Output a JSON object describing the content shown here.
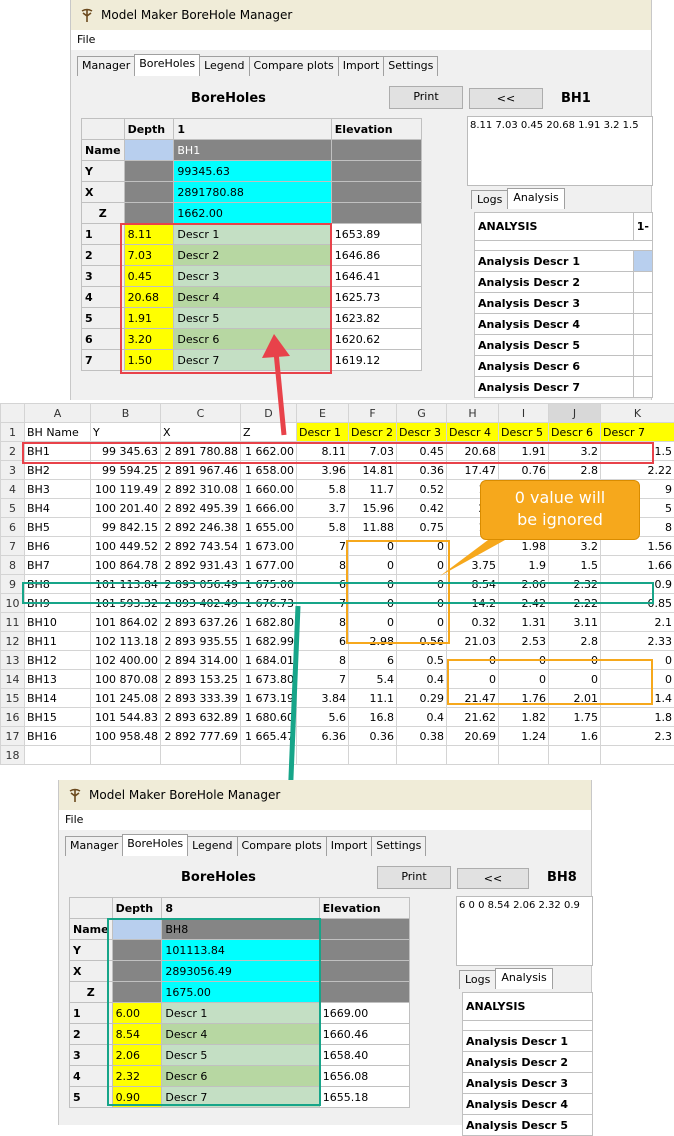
{
  "app": {
    "title": "Model Maker BoreHole Manager",
    "menu_file": "File"
  },
  "tabs": [
    "Manager",
    "BoreHoles",
    "Legend",
    "Compare plots",
    "Import",
    "Settings"
  ],
  "top": {
    "section_label": "BoreHoles",
    "print_label": "Print",
    "prev_label": "<<",
    "bh_label": "BH1",
    "memo": "8.11 7.03 0.45 20.68 1.91 3.2 1.5",
    "subtabs": [
      "Logs",
      "Analysis"
    ],
    "grid_headers": {
      "depth": "Depth",
      "col1": "1",
      "elev": "Elevation"
    },
    "info_rows": [
      {
        "label": "Name",
        "value": "BH1"
      },
      {
        "label": "Y",
        "value": "99345.63"
      },
      {
        "label": "X",
        "value": "2891780.88"
      },
      {
        "label": "Z",
        "value": "1662.00"
      }
    ],
    "rows": [
      {
        "n": "1",
        "depth": "8.11",
        "descr": "Descr 1",
        "elev": "1653.89"
      },
      {
        "n": "2",
        "depth": "7.03",
        "descr": "Descr 2",
        "elev": "1646.86"
      },
      {
        "n": "3",
        "depth": "0.45",
        "descr": "Descr 3",
        "elev": "1646.41"
      },
      {
        "n": "4",
        "depth": "20.68",
        "descr": "Descr 4",
        "elev": "1625.73"
      },
      {
        "n": "5",
        "depth": "1.91",
        "descr": "Descr 5",
        "elev": "1623.82"
      },
      {
        "n": "6",
        "depth": "3.20",
        "descr": "Descr 6",
        "elev": "1620.62"
      },
      {
        "n": "7",
        "depth": "1.50",
        "descr": "Descr 7",
        "elev": "1619.12"
      }
    ],
    "analysis_header": "ANALYSIS",
    "analysis_col": "1-",
    "analysis_rows": [
      "Analysis Descr 1",
      "Analysis Descr 2",
      "Analysis Descr 3",
      "Analysis Descr 4",
      "Analysis Descr 5",
      "Analysis Descr 6",
      "Analysis Descr 7"
    ]
  },
  "sheet": {
    "columns": [
      "A",
      "B",
      "C",
      "D",
      "E",
      "F",
      "G",
      "H",
      "I",
      "J",
      "K"
    ],
    "header": [
      "BH Name",
      "Y",
      "X",
      "Z",
      "Descr 1",
      "Descr 2",
      "Descr 3",
      "Descr 4",
      "Descr 5",
      "Descr 6",
      "Descr 7"
    ],
    "rows": [
      [
        "BH1",
        "99 345.63",
        "2 891 780.88",
        "1 662.00",
        "8.11",
        "7.03",
        "0.45",
        "20.68",
        "1.91",
        "3.2",
        "1.5"
      ],
      [
        "BH2",
        "99 594.25",
        "2 891 967.46",
        "1 658.00",
        "3.96",
        "14.81",
        "0.36",
        "17.47",
        "0.76",
        "2.8",
        "2.22"
      ],
      [
        "BH3",
        "100 119.49",
        "2 892 310.08",
        "1 660.00",
        "5.8",
        "11.7",
        "0.52",
        "19.",
        "",
        "",
        "9"
      ],
      [
        "BH4",
        "100 201.40",
        "2 892 495.39",
        "1 666.00",
        "3.7",
        "15.96",
        "0.42",
        "21.",
        "",
        "",
        "5"
      ],
      [
        "BH5",
        "99 842.15",
        "2 892 246.38",
        "1 655.00",
        "5.8",
        "11.88",
        "0.75",
        "19.",
        "",
        "",
        "8"
      ],
      [
        "BH6",
        "100 449.52",
        "2 892 743.54",
        "1 673.00",
        "7",
        "0",
        "0",
        "",
        "1.98",
        "3.2",
        "1.56"
      ],
      [
        "BH7",
        "100 864.78",
        "2 892 931.43",
        "1 677.00",
        "8",
        "0",
        "0",
        "3.75",
        "1.9",
        "1.5",
        "1.66"
      ],
      [
        "BH8",
        "101 113.84",
        "2 893 056.49",
        "1 675.00",
        "6",
        "0",
        "0",
        "8.54",
        "2.06",
        "2.32",
        "0.9"
      ],
      [
        "BH9",
        "101 593.32",
        "2 893 402.49",
        "1 676.73",
        "7",
        "0",
        "0",
        "14.2",
        "2.42",
        "2.22",
        "0.85"
      ],
      [
        "BH10",
        "101 864.02",
        "2 893 637.26",
        "1 682.80",
        "8",
        "0",
        "0",
        "0.32",
        "1.31",
        "3.11",
        "2.1"
      ],
      [
        "BH11",
        "102 113.18",
        "2 893 935.55",
        "1 682.99",
        "6",
        "2.98",
        "0.56",
        "21.03",
        "2.53",
        "2.8",
        "2.33"
      ],
      [
        "BH12",
        "102 400.00",
        "2 894 314.00",
        "1 684.01",
        "8",
        "6",
        "0.5",
        "0",
        "0",
        "0",
        "0"
      ],
      [
        "BH13",
        "100 870.08",
        "2 893 153.25",
        "1 673.80",
        "7",
        "5.4",
        "0.4",
        "0",
        "0",
        "0",
        "0"
      ],
      [
        "BH14",
        "101 245.08",
        "2 893 333.39",
        "1 673.19",
        "3.84",
        "11.1",
        "0.29",
        "21.47",
        "1.76",
        "2.01",
        "1.4"
      ],
      [
        "BH15",
        "101 544.83",
        "2 893 632.89",
        "1 680.60",
        "5.6",
        "16.8",
        "0.4",
        "21.62",
        "1.82",
        "1.75",
        "1.8"
      ],
      [
        "BH16",
        "100 958.48",
        "2 892 777.69",
        "1 665.47",
        "6.36",
        "0.36",
        "0.38",
        "20.69",
        "1.24",
        "1.6",
        "2.3"
      ]
    ],
    "row_numbers": [
      "1",
      "2",
      "3",
      "4",
      "5",
      "6",
      "7",
      "8",
      "9",
      "10",
      "11",
      "12",
      "13",
      "14",
      "15",
      "16",
      "17",
      "18"
    ]
  },
  "callout": {
    "line1": "0  value  will",
    "line2": "be ignored"
  },
  "bottom": {
    "section_label": "BoreHoles",
    "print_label": "Print",
    "prev_label": "<<",
    "bh_label": "BH8",
    "memo": "6 0 0 8.54 2.06 2.32 0.9",
    "subtabs": [
      "Logs",
      "Analysis"
    ],
    "grid_headers": {
      "depth": "Depth",
      "col1": "8",
      "elev": "Elevation"
    },
    "info_rows": [
      {
        "label": "Name",
        "value": "BH8"
      },
      {
        "label": "Y",
        "value": "101113.84"
      },
      {
        "label": "X",
        "value": "2893056.49"
      },
      {
        "label": "Z",
        "value": "1675.00"
      }
    ],
    "rows": [
      {
        "n": "1",
        "depth": "6.00",
        "descr": "Descr 1",
        "elev": "1669.00"
      },
      {
        "n": "2",
        "depth": "8.54",
        "descr": "Descr 4",
        "elev": "1660.46"
      },
      {
        "n": "3",
        "depth": "2.06",
        "descr": "Descr 5",
        "elev": "1658.40"
      },
      {
        "n": "4",
        "depth": "2.32",
        "descr": "Descr 6",
        "elev": "1656.08"
      },
      {
        "n": "5",
        "depth": "0.90",
        "descr": "Descr 7",
        "elev": "1655.18"
      }
    ],
    "analysis_header": "ANALYSIS",
    "analysis_rows": [
      "Analysis Descr 1",
      "Analysis Descr 2",
      "Analysis Descr 3",
      "Analysis Descr 4",
      "Analysis Descr 5"
    ]
  },
  "colors": {
    "highlight_red": "#e8424a",
    "highlight_orange": "#f6a81c",
    "highlight_teal": "#17a589"
  }
}
